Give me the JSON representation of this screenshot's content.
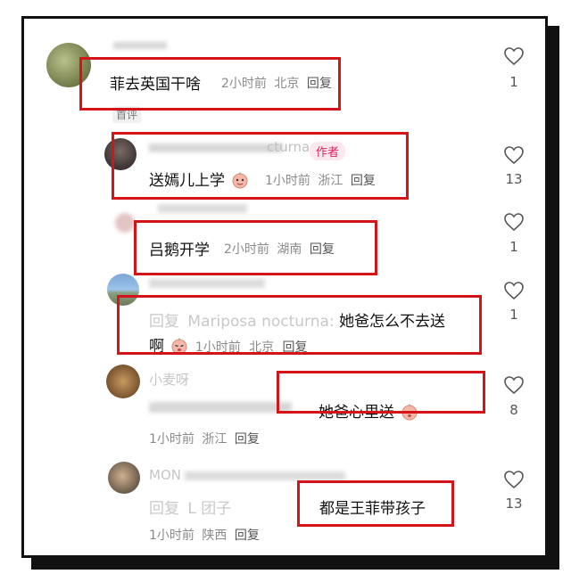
{
  "comments": [
    {
      "text": "菲去英国干啥",
      "time": "2小时前",
      "location": "北京",
      "reply_label": "回复",
      "badge": "首评",
      "likes": "1"
    },
    {
      "author_fragment": "cturna",
      "author_badge": "作者",
      "text": "送嫣儿上学",
      "time": "1小时前",
      "location": "浙江",
      "reply_label": "回复",
      "likes": "13"
    },
    {
      "text": "吕鹅开学",
      "time": "2小时前",
      "location": "湖南",
      "reply_label": "回复",
      "likes": "1"
    },
    {
      "reply_prefix": "回复",
      "reply_target": "Mariposa nocturna:",
      "text_line1": "她爸怎么不去送",
      "text_line2": "啊",
      "time": "1小时前",
      "location": "北京",
      "reply_label": "回复",
      "likes": "1"
    },
    {
      "author": "小麦呀",
      "text": "她爸心里送",
      "time": "1小时前",
      "location": "浙江",
      "reply_label": "回复",
      "likes": "8"
    },
    {
      "author_fragment": "MON",
      "reply_prefix": "回复",
      "reply_target": "L      团子",
      "text": "都是王菲带孩子",
      "time": "1小时前",
      "location": "陕西",
      "reply_label": "回复",
      "likes": "13"
    }
  ],
  "colors": {
    "highlight_box": "#d41418",
    "author_badge": "#e0245e",
    "meta_text": "#8a8a8a"
  },
  "icons": [
    "heart-icon",
    "emoji-face-icon"
  ]
}
